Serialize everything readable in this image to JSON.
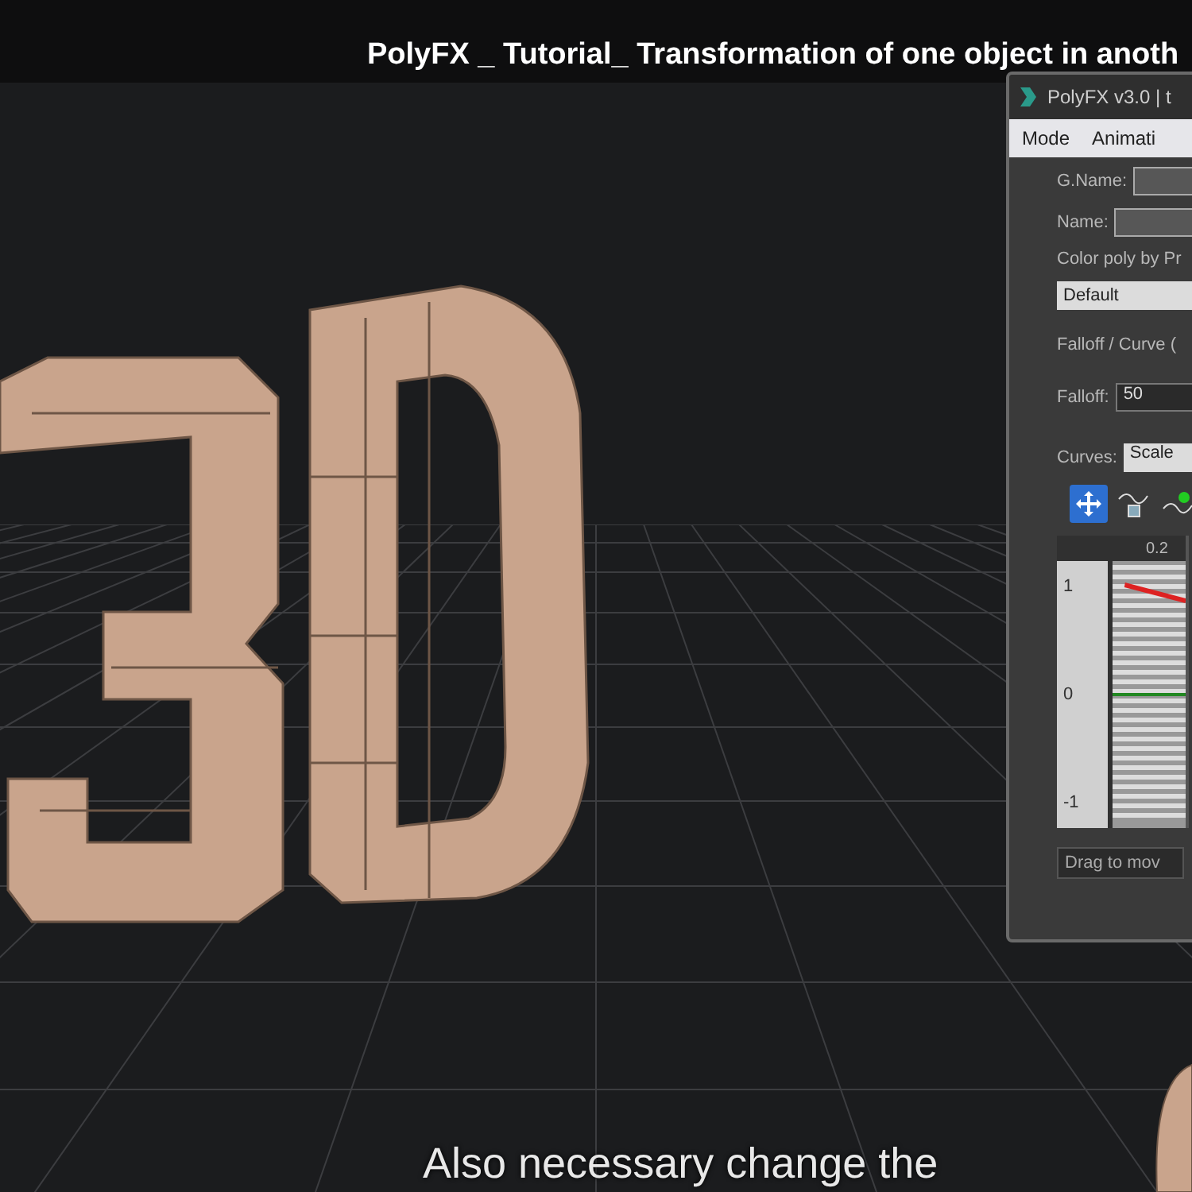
{
  "video_title": "PolyFX _ Tutorial_ Transformation of one object in anoth",
  "panel": {
    "title": "PolyFX v3.0 | t",
    "menu": [
      {
        "label": "Mode"
      },
      {
        "label": "Animati"
      }
    ],
    "fields": [
      {
        "label": "G.Name:"
      },
      {
        "label": "Name:"
      }
    ],
    "color_label": "Color poly by Pr",
    "color_dropdown": "Default",
    "section_title": "Falloff / Curve (",
    "falloff": {
      "label": "Falloff:",
      "value": "50"
    },
    "curves": {
      "label": "Curves:",
      "value": "Scale"
    },
    "tools": [
      {
        "kind": "move",
        "selected": true
      },
      {
        "kind": "curve-box",
        "selected": false
      },
      {
        "kind": "curve-dot",
        "selected": false
      }
    ],
    "curve_editor": {
      "ruler_label": "0.2",
      "y_labels": [
        "1",
        "0",
        "-1"
      ]
    },
    "drag_button": "Drag to mov"
  },
  "subtitle": "Also necessary change the"
}
